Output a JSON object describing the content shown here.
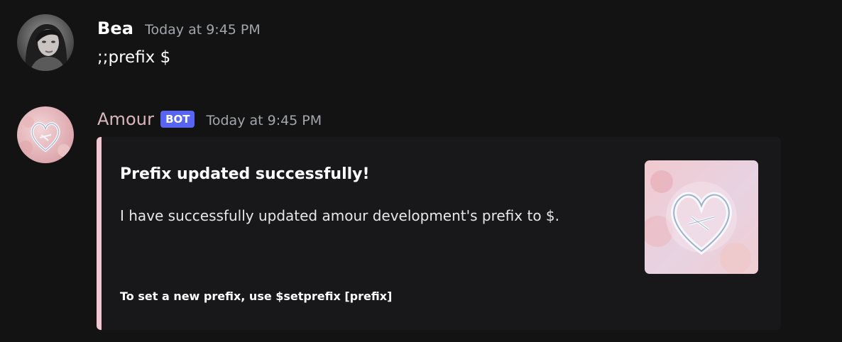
{
  "messages": [
    {
      "author": "Bea",
      "timestamp": "Today at 9:45 PM",
      "content": ";;prefix $",
      "name_color": "#ffffff"
    },
    {
      "author": "Amour",
      "bot_badge": "BOT",
      "timestamp": "Today at 9:45 PM",
      "name_color": "#d9b8bd",
      "embed": {
        "color": "#f2c7d3",
        "title": "Prefix updated successfully!",
        "description": "I have successfully updated amour development's prefix to $.",
        "footer": "To set a new prefix, use $setprefix [prefix]",
        "thumbnail": "heart-logo-image"
      }
    }
  ]
}
